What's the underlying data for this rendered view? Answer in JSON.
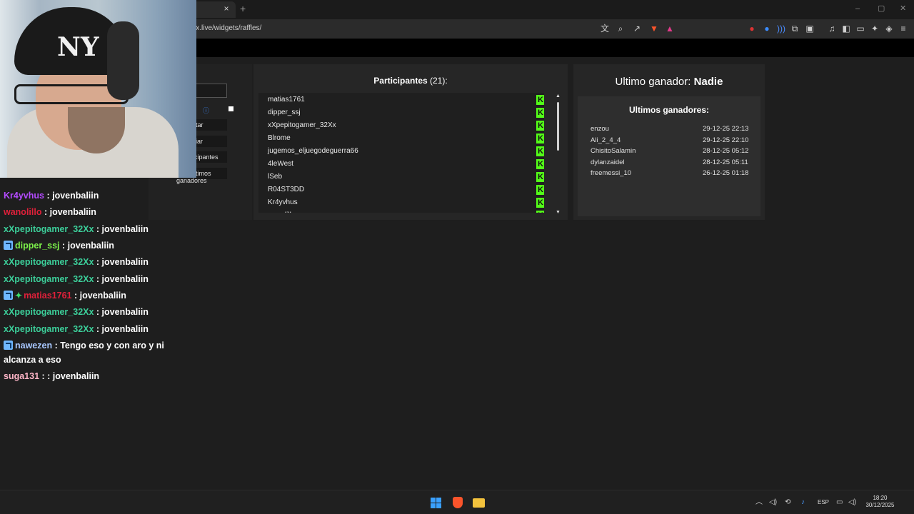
{
  "browser": {
    "tab_close": "×",
    "new_tab": "+",
    "url": "ix.live/widgets/raffles/",
    "window_controls": {
      "minimize": "–",
      "maximize": "▢",
      "close": "✕"
    },
    "toolbar_icons": [
      "translate-icon",
      "zoom-icon",
      "share-icon",
      "brave-shields-icon",
      "brave-rewards-icon",
      "record-icon",
      "extension-blue-icon",
      "audio-icon",
      "screenshot-icon",
      "puzzle-icon",
      "music-icon",
      "sidebar-icon",
      "wallet-icon",
      "leo-icon",
      "vpn-icon",
      "menu-icon"
    ]
  },
  "controls": {
    "buttons": [
      {
        "label": "tar"
      },
      {
        "label": "iar"
      },
      {
        "label": "icipantes"
      },
      {
        "label": "timos"
      }
    ],
    "ganadores_label": "ganadores",
    "info_glyph": "ⓘ"
  },
  "participants": {
    "title": "Participantes",
    "count": "(21):",
    "badge_letter": "K",
    "items": [
      "matias1761",
      "dipper_ssj",
      "xXpepitogamer_32Xx",
      "Blrome",
      "jugemos_eljuegodeguerra66",
      "4leWest",
      "lSeb",
      "R04ST3DD",
      "Kr4yvhus",
      "wanolillo"
    ],
    "scroll_up": "▲",
    "scroll_down": "▼"
  },
  "winner": {
    "label": "Ultimo ganador:",
    "name": "Nadie",
    "list_title": "Ultimos ganadores:",
    "list": [
      {
        "name": "enzou",
        "date": "29-12-25 22:13"
      },
      {
        "name": "Ali_2_4_4",
        "date": "29-12-25 22:10"
      },
      {
        "name": "ChisitoSalamin",
        "date": "28-12-25 05:12"
      },
      {
        "name": "dylanzaidel",
        "date": "28-12-25 05:11"
      },
      {
        "name": "freemessi_10",
        "date": "26-12-25 01:18"
      }
    ]
  },
  "webcam": {
    "cap_logo": "NY"
  },
  "chat": [
    {
      "user": "Kr4yvhus",
      "color": "#b44bff",
      "msg": " : jovenbaliin"
    },
    {
      "user": "wanolillo",
      "color": "#e0203a",
      "msg": " : jovenbaliin"
    },
    {
      "user": "xXpepitogamer_32Xx",
      "color": "#3ccf9a",
      "msg": " : jovenbaliin"
    },
    {
      "user": "dipper_ssj",
      "color": "#7cf04a",
      "msg": " : jovenbaliin",
      "badge": "arrow"
    },
    {
      "user": "xXpepitogamer_32Xx",
      "color": "#3ccf9a",
      "msg": " : jovenbaliin"
    },
    {
      "user": "xXpepitogamer_32Xx",
      "color": "#3ccf9a",
      "msg": " : jovenbaliin"
    },
    {
      "user": "matias1761",
      "color": "#e0203a",
      "msg": " : jovenbaliin",
      "badge": "arrow-star"
    },
    {
      "user": "xXpepitogamer_32Xx",
      "color": "#3ccf9a",
      "msg": " : jovenbaliin"
    },
    {
      "user": "xXpepitogamer_32Xx",
      "color": "#3ccf9a",
      "msg": " : jovenbaliin"
    },
    {
      "user": "nawezen",
      "color": "#a9c8ff",
      "msg": " : Tengo eso y con aro y ni",
      "badge": "arrow"
    },
    {
      "user": "",
      "color": "#ffffff",
      "msg": "alcanza a eso",
      "continuation": true
    },
    {
      "user": "suga131",
      "color": "#ffb6c8",
      "msg": " : : jovenbaliin"
    }
  ],
  "taskbar": {
    "language": "ESP",
    "time": "18:20",
    "date": "30/12/2025",
    "tray_icons": [
      "chevron-up-icon",
      "volume-icon",
      "sync-icon",
      "microphone-icon",
      "display-icon",
      "speaker-icon"
    ]
  }
}
